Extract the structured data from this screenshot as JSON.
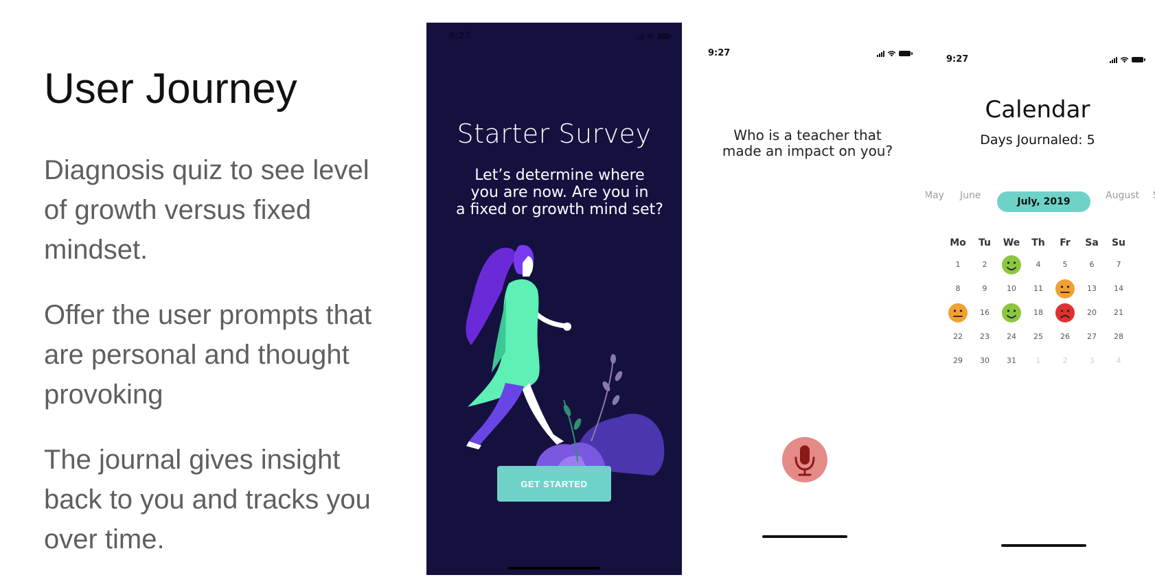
{
  "slide": {
    "title": "User Journey",
    "paragraphs": [
      "Diagnosis quiz to see level of growth versus fixed mindset.",
      "Offer the user prompts that are personal and thought provoking",
      "The journal gives insight back to you and tracks you over time."
    ]
  },
  "survey_screen": {
    "time": "9:27",
    "title": "Starter Survey",
    "body_lines": [
      "Let’s determine where",
      "you are now. Are you in",
      "a fixed or growth mind set?"
    ],
    "button_label": "GET STARTED",
    "colors": {
      "background": "#14113f",
      "button": "#6fd2c9"
    }
  },
  "prompt_screen": {
    "time": "9:27",
    "question_lines": [
      "Who is a teacher that",
      "made an impact on you?"
    ],
    "mic_color": "#e48a87"
  },
  "calendar_screen": {
    "time": "9:27",
    "title": "Calendar",
    "subtitle": "Days Journaled: 5",
    "months": {
      "prev2": "May",
      "prev": "June",
      "current": "July, 2019",
      "next": "August",
      "next2": "S"
    },
    "weekdays": [
      "Mo",
      "Tu",
      "We",
      "Th",
      "Fr",
      "Sa",
      "Su"
    ],
    "weeks": [
      [
        "1",
        "2",
        "3",
        "4",
        "5",
        "6",
        "7"
      ],
      [
        "8",
        "9",
        "10",
        "11",
        "12",
        "13",
        "14"
      ],
      [
        "15",
        "16",
        "17",
        "18",
        "19",
        "20",
        "21"
      ],
      [
        "22",
        "23",
        "24",
        "25",
        "26",
        "27",
        "28"
      ],
      [
        "29",
        "30",
        "31",
        "1",
        "2",
        "3",
        "4"
      ]
    ],
    "moods": {
      "3": "happy",
      "12": "neutral",
      "15": "neutral",
      "17": "happy",
      "19": "sad"
    },
    "faded_cells": [
      [
        4,
        3
      ],
      [
        4,
        4
      ],
      [
        4,
        5
      ],
      [
        4,
        6
      ]
    ],
    "mood_colors": {
      "happy": "#8cc63f",
      "neutral": "#f2a033",
      "sad": "#e03131"
    },
    "accent": "#6fd2c9"
  }
}
